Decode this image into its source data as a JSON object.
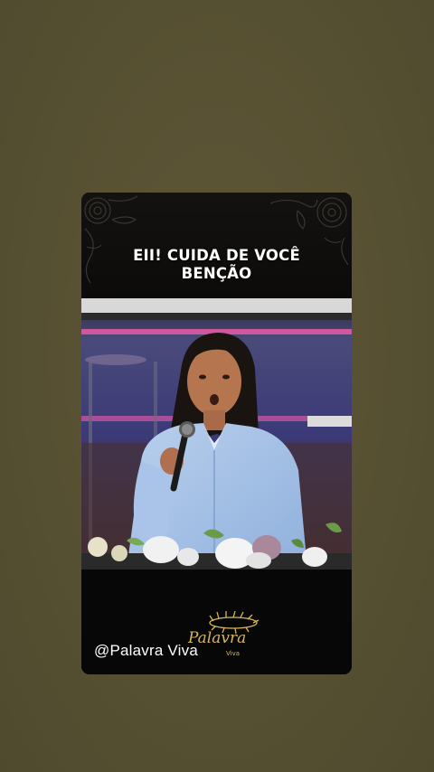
{
  "colors": {
    "background": "#5a5233",
    "card": "#0b0b0b",
    "headline_text": "#ffffff",
    "logo_gold": "#d7b75a",
    "accent_light": "#ff5fb0"
  },
  "headline": {
    "line1": "EII! CUIDA DE VOCÊ",
    "line2": "BENÇÃO"
  },
  "footer": {
    "handle": "@Palavra Viva"
  },
  "logo": {
    "script_text": "Palavra",
    "sub_text": "Viva",
    "icon": "crown-of-thorns-icon"
  },
  "scene": {
    "subject": "woman-speaking-icon",
    "microphone": "microphone-icon",
    "flowers": "flower-arrangement-icon"
  }
}
